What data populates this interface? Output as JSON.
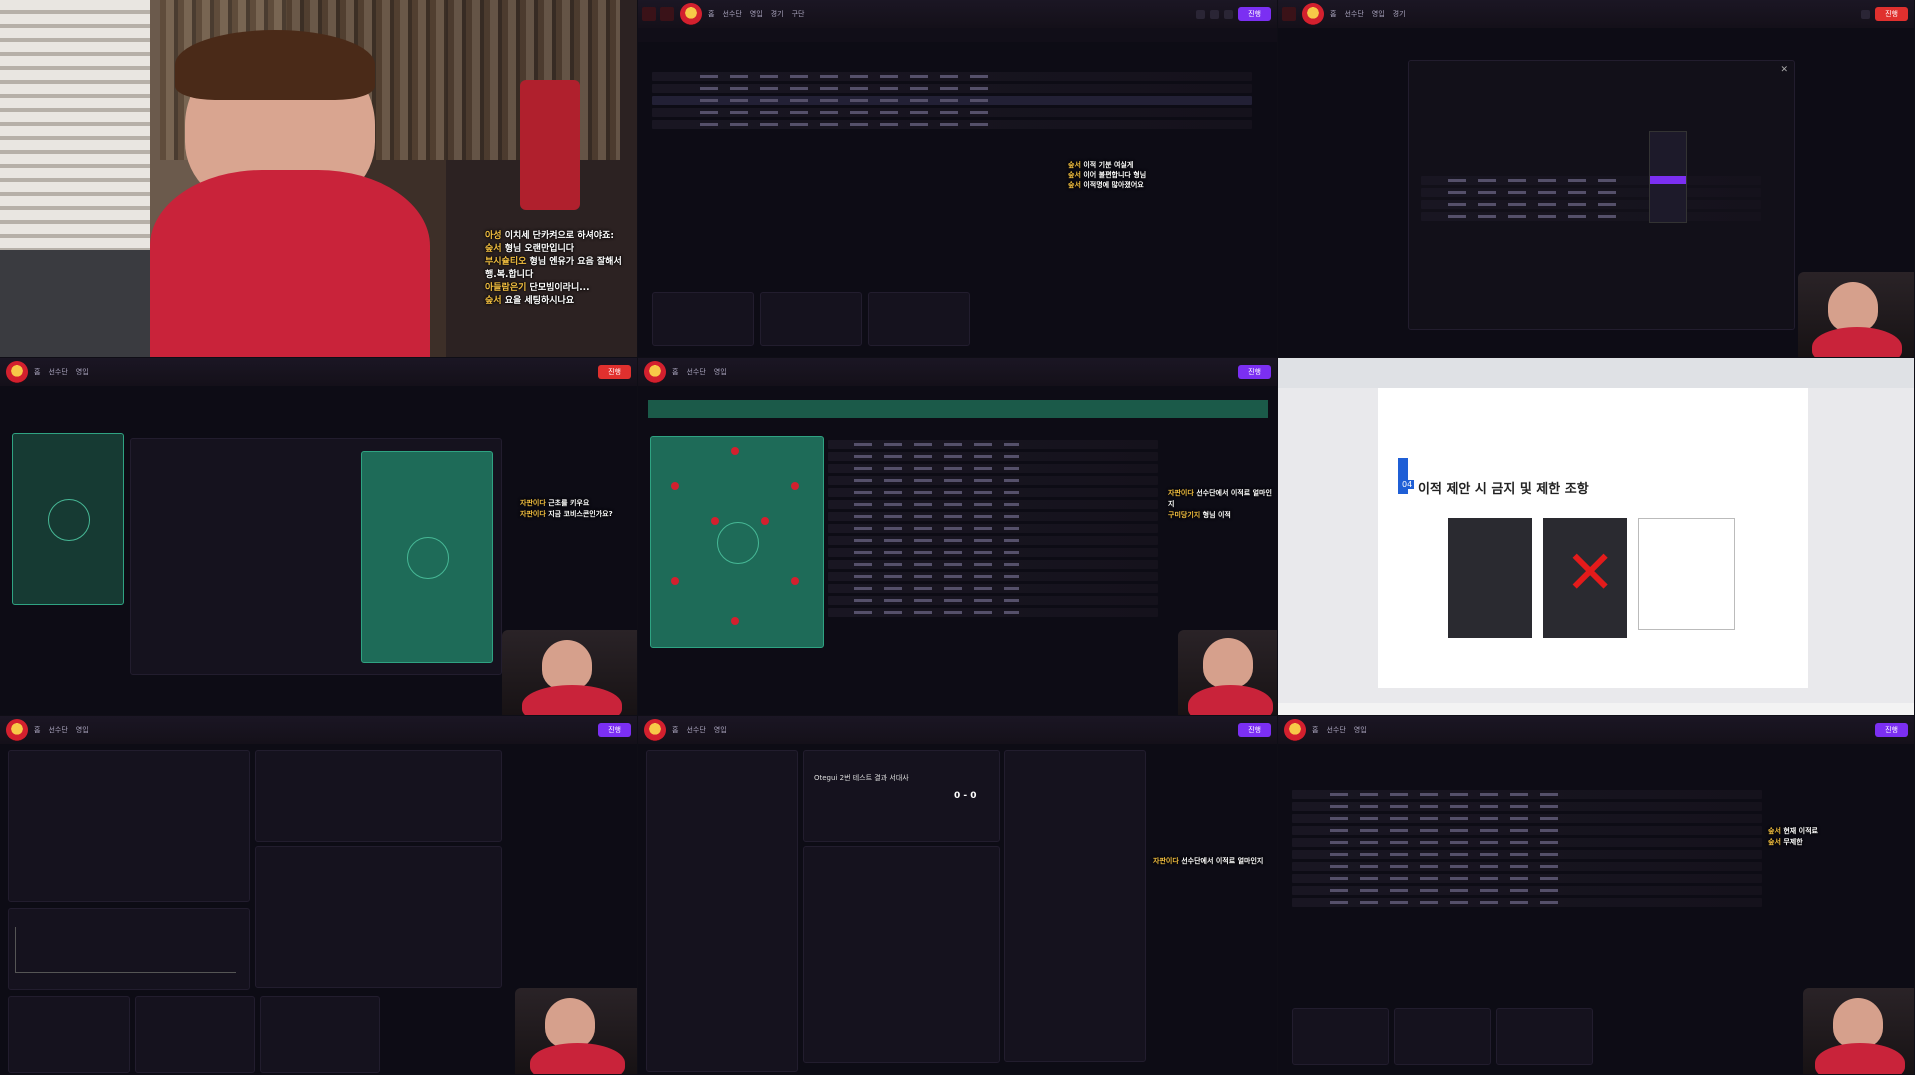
{
  "stream": {
    "chat_messages": [
      {
        "user": "아성",
        "text": "이치세 단카켜으로 하셔야죠:"
      },
      {
        "user": "숲서",
        "text": "형님 오랜만입니다"
      },
      {
        "user": "부시슐티오",
        "text": "형님 엔유가 요음 잘해서 행.복.합니다"
      },
      {
        "user": "아들람은기",
        "text": "단모빔이라니..."
      },
      {
        "user": "숲서",
        "text": "요을 세팅하시나요"
      }
    ]
  },
  "game": {
    "menu": [
      "홈",
      "선수단",
      "영입",
      "경기",
      "구단"
    ],
    "topbar_button": "진행",
    "side_chat_1": [
      {
        "user": "숲서",
        "text": "이적 기분 여실게"
      },
      {
        "user": "숲서",
        "text": "이어 불편합니다 형님"
      },
      {
        "user": "숲서",
        "text": "이적명에 많아졌어요"
      }
    ],
    "side_chat_2": [
      {
        "user": "자판이다",
        "text": "근초를 키우요"
      },
      {
        "user": "자판이다",
        "text": "지금 코비스콘인가요?"
      }
    ],
    "side_chat_3": [
      {
        "user": "자판이다",
        "text": "선수단에서 이적료 얼마인지"
      },
      {
        "user": "구미당기지",
        "text": "형님 이적"
      }
    ],
    "side_chat_4": [
      {
        "user": "숲서",
        "text": "현재 이적료"
      },
      {
        "user": "숲서",
        "text": "무제한"
      }
    ],
    "match_title": "Otegui 2번 테스트 결과 서대사",
    "match_score": "0 - 0"
  },
  "document": {
    "section_number": "04",
    "section_title": "이적 제안 시 금지 및 제한 조항"
  },
  "colors": {
    "accent_purple": "#7b2ff2",
    "accent_red": "#e0302e",
    "pitch_green": "#1e6b58",
    "background": "#0d0c15"
  }
}
